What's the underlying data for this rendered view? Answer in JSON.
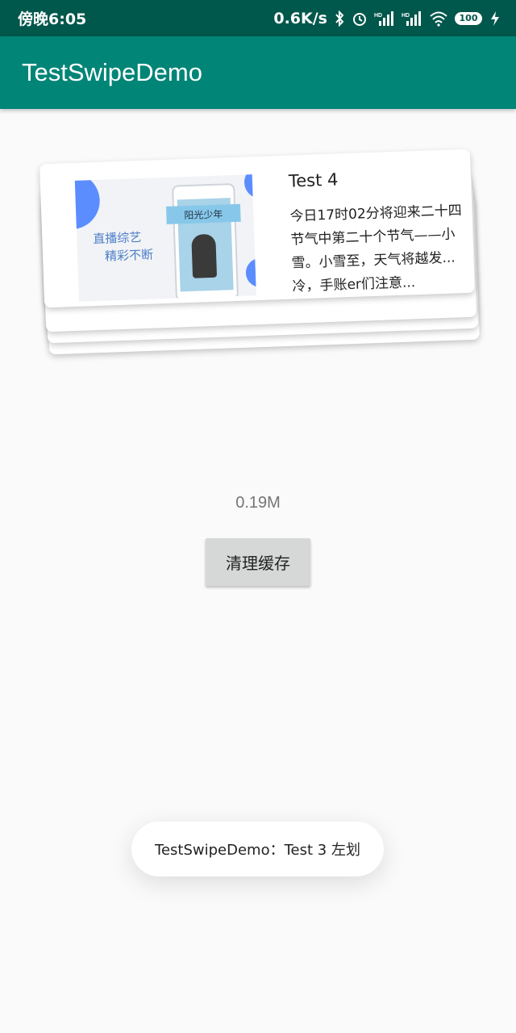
{
  "status_bar": {
    "time": "傍晚6:05",
    "net_speed": "0.6K/s",
    "battery": "100",
    "icons": [
      "bluetooth-icon",
      "alarm-icon",
      "signal-hd-icon",
      "signal-hd-icon",
      "wifi-icon",
      "battery-icon",
      "charging-icon"
    ]
  },
  "app_bar": {
    "title": "TestSwipeDemo"
  },
  "card": {
    "title": "Test 4",
    "description": "今日17时02分将迎来二十四节气中第二十个节气——小雪。小雪至，天气将越发...冷，手账er们注意...",
    "image_text_1": "直播综艺",
    "image_text_2": "精彩不断",
    "image_banner": "阳光少年"
  },
  "cache": {
    "size": "0.19M",
    "button_label": "清理缓存"
  },
  "toast": {
    "message": "TestSwipeDemo：Test 3 左划"
  },
  "colors": {
    "status_bar": "#00574b",
    "app_bar": "#008577",
    "background": "#fafafa",
    "button": "#d6d7d7"
  }
}
